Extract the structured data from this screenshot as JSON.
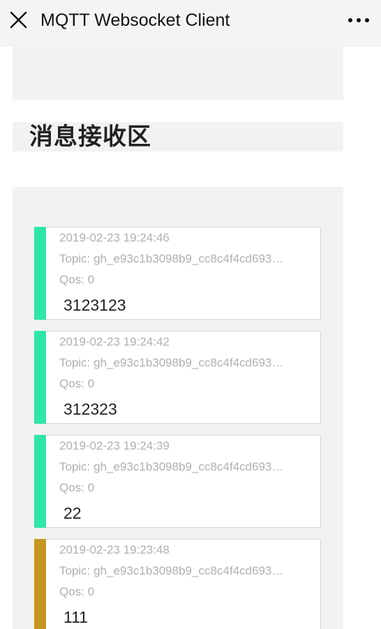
{
  "window": {
    "title": "MQTT Websocket Client",
    "close_icon": "close-icon",
    "more_icon": "more-dots-icon"
  },
  "receive_section": {
    "title": "消息接收区"
  },
  "colors": {
    "accent_ok": "#2ee6a8",
    "accent_old": "#c8961e"
  },
  "messages": [
    {
      "time": "2019-02-23 19:24:46",
      "topic": "Topic: gh_e93c1b3098b9_cc8c4f4cd693…",
      "qos": "Qos: 0",
      "payload": "3123123",
      "accent": "#2ee6a8"
    },
    {
      "time": "2019-02-23 19:24:42",
      "topic": "Topic: gh_e93c1b3098b9_cc8c4f4cd693…",
      "qos": "Qos: 0",
      "payload": "312323",
      "accent": "#2ee6a8"
    },
    {
      "time": "2019-02-23 19:24:39",
      "topic": "Topic: gh_e93c1b3098b9_cc8c4f4cd693…",
      "qos": "Qos: 0",
      "payload": "22",
      "accent": "#2ee6a8"
    },
    {
      "time": "2019-02-23 19:23:48",
      "topic": "Topic: gh_e93c1b3098b9_cc8c4f4cd693…",
      "qos": "Qos: 0",
      "payload": "111",
      "accent": "#c8961e"
    }
  ]
}
